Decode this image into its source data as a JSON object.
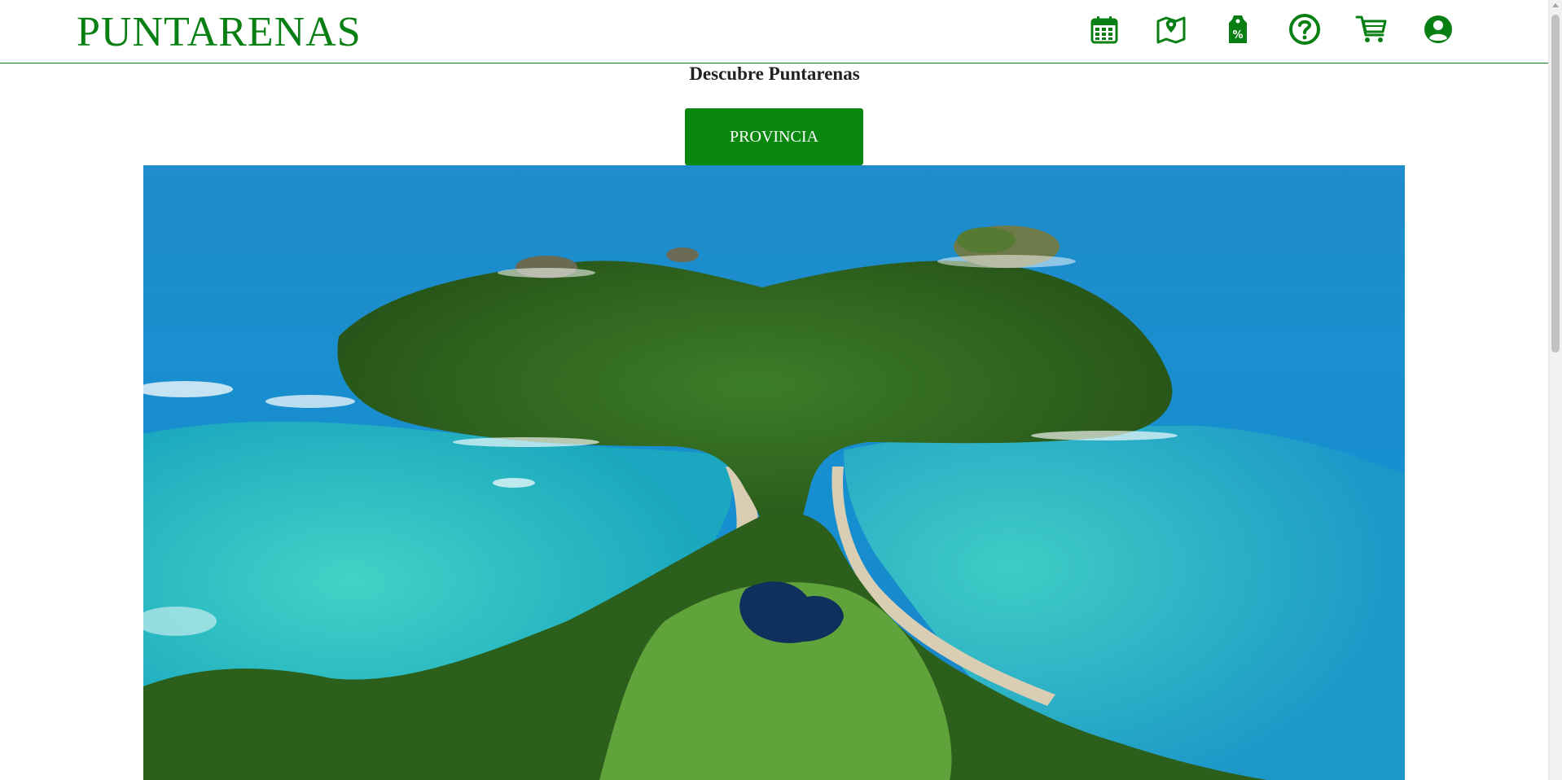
{
  "header": {
    "brand": "PUNTARENAS",
    "nav": [
      {
        "icon": "calendar-icon",
        "name": "calendar"
      },
      {
        "icon": "map-pin-icon",
        "name": "map"
      },
      {
        "icon": "discount-tag-icon",
        "name": "offers"
      },
      {
        "icon": "help-icon",
        "name": "help"
      },
      {
        "icon": "cart-icon",
        "name": "cart"
      },
      {
        "icon": "user-icon",
        "name": "account"
      }
    ],
    "discount_glyph": "%"
  },
  "main": {
    "heading": "Descubre Puntarenas",
    "cta_label": "PROVINCIA",
    "hero_subject": "Aerial view of a forested tropical peninsula with turquoise bays"
  },
  "colors": {
    "brand": "#087f13",
    "button": "#0a870f",
    "ocean": "#1a8fd0",
    "lagoon": "#2cc1b8",
    "forest": "#2f6b1f"
  }
}
